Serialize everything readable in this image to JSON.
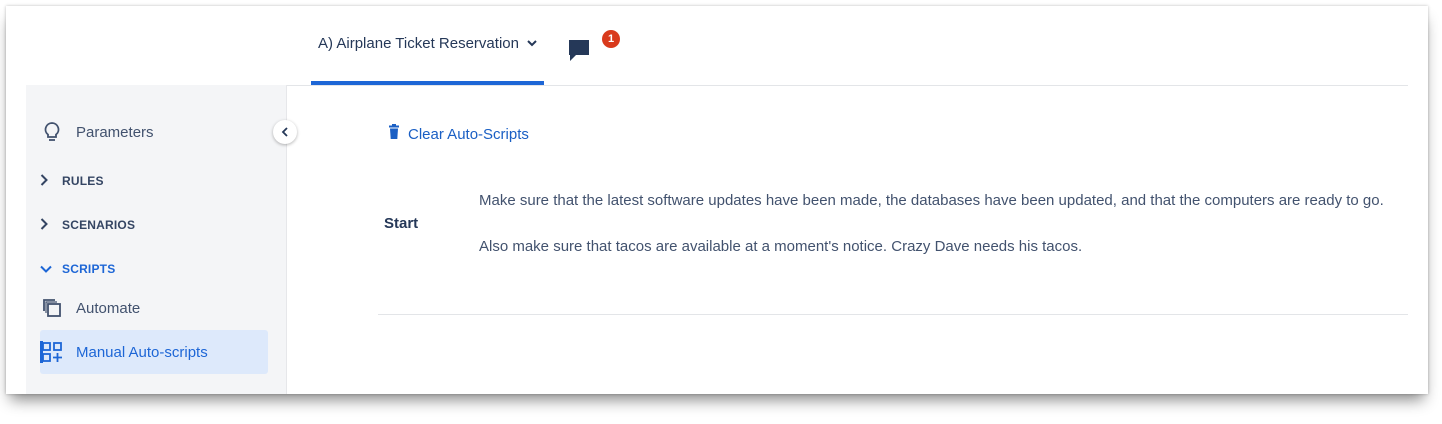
{
  "header": {
    "project_tab": "A) Airplane Ticket Reservation",
    "notification_count": "1"
  },
  "sidebar": {
    "parameters": "Parameters",
    "groups": {
      "rules": "RULES",
      "scenarios": "SCENARIOS",
      "scripts": "SCRIPTS"
    },
    "scripts_items": {
      "automate": "Automate",
      "manual": "Manual Auto-scripts"
    }
  },
  "main": {
    "clear_label": "Clear Auto-Scripts",
    "step": {
      "name": "Start",
      "lines": [
        "Make sure that the latest software updates have been made, the databases have been updated, and that the computers are ready to go.",
        "Also make sure that tacos are available at a moment's notice. Crazy Dave needs his tacos."
      ]
    }
  },
  "colors": {
    "accent": "#1d66d6",
    "badge": "#d93a1c",
    "sidebar_bg": "#f4f5f7",
    "active_item_bg": "#dde9fb"
  },
  "icons": [
    "chat-icon",
    "lightbulb-icon",
    "chevron-right-icon",
    "chevron-down-icon",
    "copy-icon",
    "grid-add-icon",
    "trash-icon",
    "chevron-left-icon"
  ]
}
